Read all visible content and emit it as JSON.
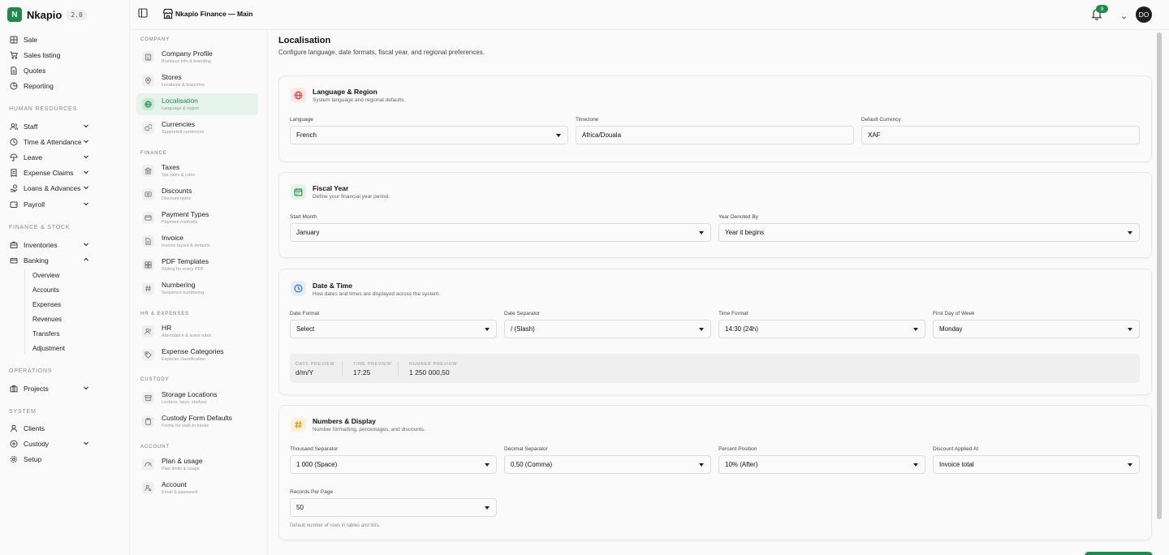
{
  "brand": {
    "name": "Nkapio",
    "version": "2.0"
  },
  "sidebar": {
    "top_items": [
      {
        "label": "Sale",
        "icon": "grid-icon"
      },
      {
        "label": "Sales listing",
        "icon": "cart-icon"
      },
      {
        "label": "Quotes",
        "icon": "document-icon"
      },
      {
        "label": "Reporting",
        "icon": "chart-icon"
      }
    ],
    "sections": [
      {
        "title": "HUMAN RESOURCES",
        "items": [
          {
            "label": "Staff",
            "expandable": true
          },
          {
            "label": "Time & Attendance",
            "expandable": true
          },
          {
            "label": "Leave",
            "expandable": true
          },
          {
            "label": "Expense Claims",
            "expandable": true
          },
          {
            "label": "Loans & Advances",
            "expandable": true
          },
          {
            "label": "Payroll",
            "expandable": true
          }
        ]
      },
      {
        "title": "FINANCE & STOCK",
        "items": [
          {
            "label": "Inventories",
            "expandable": true
          },
          {
            "label": "Banking",
            "expandable": true,
            "expanded": true
          }
        ]
      },
      {
        "title": "OPERATIONS",
        "items": [
          {
            "label": "Projects",
            "expandable": true
          }
        ]
      },
      {
        "title": "SYSTEM",
        "items": [
          {
            "label": "Clients",
            "expandable": false
          },
          {
            "label": "Custody",
            "expandable": true
          },
          {
            "label": "Setup",
            "expandable": false
          }
        ]
      }
    ],
    "banking_sub": [
      "Overview",
      "Accounts",
      "Expenses",
      "Revenues",
      "Transfers",
      "Adjustment"
    ]
  },
  "topbar": {
    "title": "Nkapio Finance — Main",
    "notification_count": "9",
    "avatar_initials": "DO"
  },
  "settings_nav": {
    "sections": [
      {
        "title": "COMPANY",
        "items": [
          {
            "title": "Company Profile",
            "sub": "Business info & branding"
          },
          {
            "title": "Stores",
            "sub": "Locations & branches"
          },
          {
            "title": "Localisation",
            "sub": "Language & region",
            "active": true
          },
          {
            "title": "Currencies",
            "sub": "Supported currencies"
          }
        ]
      },
      {
        "title": "FINANCE",
        "items": [
          {
            "title": "Taxes",
            "sub": "Tax rates & rules"
          },
          {
            "title": "Discounts",
            "sub": "Discount types"
          },
          {
            "title": "Payment Types",
            "sub": "Payment methods"
          },
          {
            "title": "Invoice",
            "sub": "Invoice layout & defaults"
          },
          {
            "title": "PDF Templates",
            "sub": "Styling for every PDF"
          },
          {
            "title": "Numbering",
            "sub": "Sequence numbering"
          }
        ]
      },
      {
        "title": "HR & EXPENSES",
        "items": [
          {
            "title": "HR",
            "sub": "Attendance & leave rules"
          },
          {
            "title": "Expense Categories",
            "sub": "Expense classification"
          }
        ]
      },
      {
        "title": "CUSTODY",
        "items": [
          {
            "title": "Storage Locations",
            "sub": "Lockers, bays, shelves"
          },
          {
            "title": "Custody Form Defaults",
            "sub": "Forms for walk-in intake"
          }
        ]
      },
      {
        "title": "ACCOUNT",
        "items": [
          {
            "title": "Plan & usage",
            "sub": "Plan limits & usage"
          },
          {
            "title": "Account",
            "sub": "Email & password"
          }
        ]
      }
    ]
  },
  "page": {
    "title": "Localisation",
    "subtitle": "Configure language, date formats, fiscal year, and regional preferences."
  },
  "cards": {
    "language": {
      "title": "Language & Region",
      "sub": "System language and regional defaults.",
      "fields": [
        {
          "label": "Language",
          "value": "French",
          "type": "select"
        },
        {
          "label": "Timezone",
          "value": "Africa/Douala",
          "type": "input"
        },
        {
          "label": "Default Currency",
          "value": "XAF",
          "type": "input"
        }
      ]
    },
    "fiscal": {
      "title": "Fiscal Year",
      "sub": "Define your financial year period.",
      "fields": [
        {
          "label": "Start Month",
          "value": "January",
          "type": "select"
        },
        {
          "label": "Year Denoted By",
          "value": "Year it begins",
          "type": "select"
        }
      ]
    },
    "datetime": {
      "title": "Date & Time",
      "sub": "How dates and times are displayed across the system.",
      "fields": [
        {
          "label": "Date Format",
          "value": "Select",
          "type": "select"
        },
        {
          "label": "Date Separator",
          "value": "/ (Slash)",
          "type": "select"
        },
        {
          "label": "Time Format",
          "value": "14:30 (24h)",
          "type": "select"
        },
        {
          "label": "First Day of Week",
          "value": "Monday",
          "type": "select"
        }
      ],
      "preview": [
        {
          "label": "DATE PREVIEW",
          "value": "d/m/Y"
        },
        {
          "label": "TIME PREVIEW",
          "value": "17:25"
        },
        {
          "label": "NUMBER PREVIEW",
          "value": "1 250 000,50"
        }
      ]
    },
    "numbers": {
      "title": "Numbers & Display",
      "sub": "Number formatting, percentages, and discounts.",
      "fields": [
        {
          "label": "Thousand Separator",
          "value": "1 000 (Space)",
          "type": "select"
        },
        {
          "label": "Decimal Separator",
          "value": "0,50 (Comma)",
          "type": "select"
        },
        {
          "label": "Percent Position",
          "value": "10% (After)",
          "type": "select"
        },
        {
          "label": "Discount Applied At",
          "value": "Invoice total",
          "type": "select"
        },
        {
          "label": "Records Per Page",
          "value": "50",
          "type": "select"
        }
      ],
      "hint": "Default number of rows in tables and lists."
    }
  },
  "colors": {
    "accent": "#1f8a4c",
    "language_icon": "#e0483f",
    "fiscal_icon": "#1f8a4c",
    "datetime_icon": "#2f6fd1",
    "numbers_icon": "#d99a1a"
  }
}
